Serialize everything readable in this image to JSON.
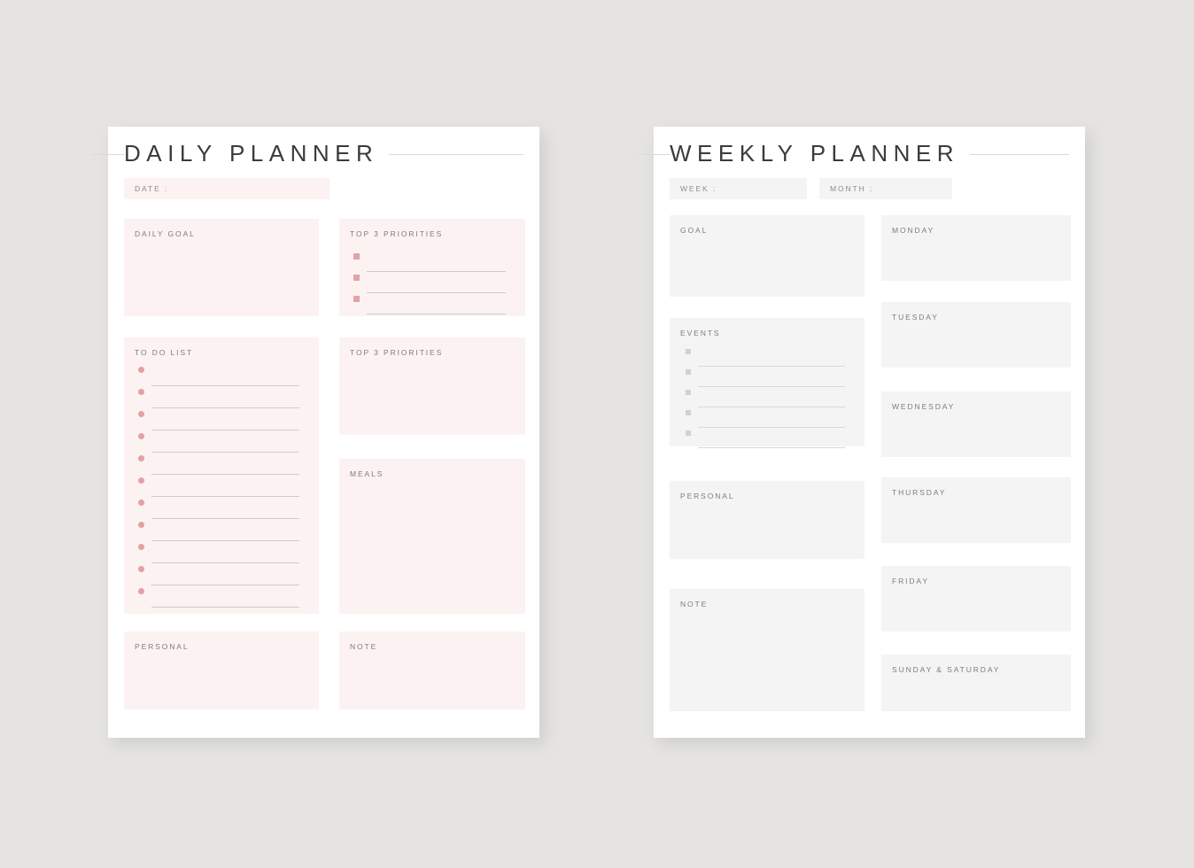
{
  "theme": {
    "background": "#e5e4e2",
    "page_background": "#ffffff",
    "daily_accent": "#fcf2f2",
    "daily_bullet": "#e4a0a4",
    "weekly_accent": "#f4f4f4",
    "weekly_bullet": "#cdd2d8",
    "title_color": "#3b3b3b",
    "label_color": "#7e7c7c",
    "rule_color": "#dcdad8"
  },
  "daily": {
    "title": "DAILY PLANNER",
    "date_label": "DATE :",
    "date_value": "",
    "goal": {
      "header": "DAILY GOAL",
      "value": ""
    },
    "top3_primary": {
      "header": "TOP 3 PRIORITIES",
      "bullet_style": "square",
      "items": [
        "",
        "",
        ""
      ]
    },
    "todo": {
      "header": "TO DO LIST",
      "bullet_style": "round",
      "items": [
        "",
        "",
        "",
        "",
        "",
        "",
        "",
        "",
        "",
        "",
        ""
      ]
    },
    "top3_secondary": {
      "header": "TOP 3 PRIORITIES",
      "value": ""
    },
    "meals": {
      "header": "MEALS",
      "value": ""
    },
    "personal": {
      "header": "PERSONAL",
      "value": ""
    },
    "note": {
      "header": "NOTE",
      "value": ""
    }
  },
  "weekly": {
    "title": "WEEKLY PLANNER",
    "week_label": "WEEK :",
    "week_value": "",
    "month_label": "MONTH :",
    "month_value": "",
    "goal": {
      "header": "GOAL",
      "value": ""
    },
    "events": {
      "header": "EVENTS",
      "bullet_style": "square",
      "items": [
        "",
        "",
        "",
        "",
        ""
      ]
    },
    "personal": {
      "header": "PERSONAL",
      "value": ""
    },
    "note": {
      "header": "NOTE",
      "value": ""
    },
    "days": [
      {
        "header": "MONDAY",
        "value": ""
      },
      {
        "header": "TUESDAY",
        "value": ""
      },
      {
        "header": "WEDNESDAY",
        "value": ""
      },
      {
        "header": "THURSDAY",
        "value": ""
      },
      {
        "header": "FRIDAY",
        "value": ""
      },
      {
        "header": "SUNDAY & SATURDAY",
        "value": ""
      }
    ]
  }
}
